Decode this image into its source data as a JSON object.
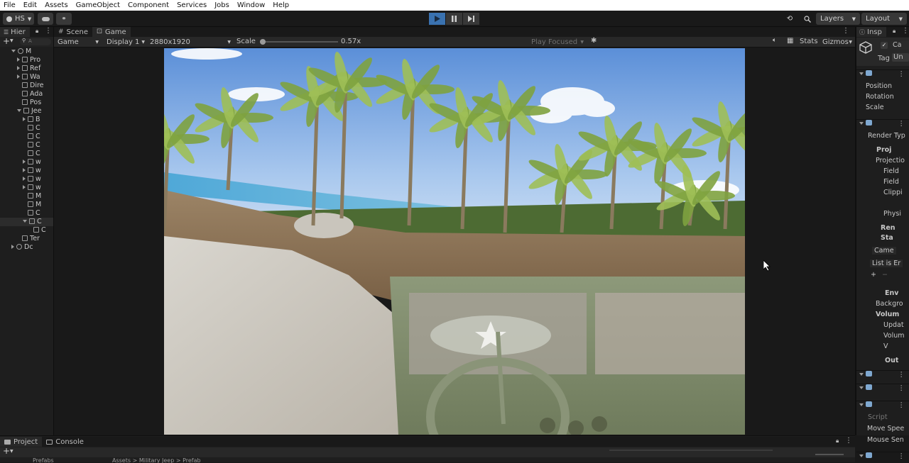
{
  "menu": [
    "File",
    "Edit",
    "Assets",
    "GameObject",
    "Component",
    "Services",
    "Jobs",
    "Window",
    "Help"
  ],
  "toolbar": {
    "account_label": "HS",
    "layers_label": "Layers",
    "layout_label": "Layout"
  },
  "hierarchy": {
    "tab_label": "Hier",
    "search_placeholder": "A",
    "items": [
      {
        "label": "M",
        "indent": 0,
        "expand": "open",
        "kind": "scene"
      },
      {
        "label": "Pro",
        "indent": 1,
        "expand": "closed",
        "kind": "object"
      },
      {
        "label": "Ref",
        "indent": 1,
        "expand": "closed",
        "kind": "object"
      },
      {
        "label": "Wa",
        "indent": 1,
        "expand": "closed",
        "kind": "object"
      },
      {
        "label": "Dire",
        "indent": 1,
        "expand": "none",
        "kind": "object"
      },
      {
        "label": "Ada",
        "indent": 1,
        "expand": "none",
        "kind": "object"
      },
      {
        "label": "Pos",
        "indent": 1,
        "expand": "none",
        "kind": "object"
      },
      {
        "label": "Jee",
        "indent": 1,
        "expand": "open",
        "kind": "object"
      },
      {
        "label": "B",
        "indent": 2,
        "expand": "closed",
        "kind": "object"
      },
      {
        "label": "C",
        "indent": 2,
        "expand": "none",
        "kind": "object"
      },
      {
        "label": "C",
        "indent": 2,
        "expand": "none",
        "kind": "object"
      },
      {
        "label": "C",
        "indent": 2,
        "expand": "none",
        "kind": "object"
      },
      {
        "label": "C",
        "indent": 2,
        "expand": "none",
        "kind": "object"
      },
      {
        "label": "w",
        "indent": 2,
        "expand": "closed",
        "kind": "object"
      },
      {
        "label": "w",
        "indent": 2,
        "expand": "closed",
        "kind": "object"
      },
      {
        "label": "w",
        "indent": 2,
        "expand": "closed",
        "kind": "object"
      },
      {
        "label": "w",
        "indent": 2,
        "expand": "closed",
        "kind": "object"
      },
      {
        "label": "M",
        "indent": 2,
        "expand": "none",
        "kind": "object"
      },
      {
        "label": "M",
        "indent": 2,
        "expand": "none",
        "kind": "object"
      },
      {
        "label": "C",
        "indent": 2,
        "expand": "none",
        "kind": "object"
      },
      {
        "label": "C",
        "indent": 2,
        "expand": "open",
        "kind": "object",
        "selected": true
      },
      {
        "label": "C",
        "indent": 3,
        "expand": "none",
        "kind": "object"
      },
      {
        "label": "Ter",
        "indent": 1,
        "expand": "none",
        "kind": "object"
      },
      {
        "label": "Dc",
        "indent": 0,
        "expand": "closed",
        "kind": "scene"
      }
    ]
  },
  "center": {
    "tabs": [
      {
        "label": "Scene",
        "icon": "hash-icon",
        "active": false
      },
      {
        "label": "Game",
        "icon": "gamepad-icon",
        "active": true
      }
    ],
    "game_toolbar": {
      "view_mode": "Game",
      "display": "Display 1",
      "resolution": "2880x1920",
      "scale_label": "Scale",
      "scale_value": "0.57x",
      "scale_fraction": 0.0,
      "play_mode": "Play Focused",
      "stats_label": "Stats",
      "gizmos_label": "Gizmos"
    }
  },
  "inspector": {
    "tab_label": "Insp",
    "object_name": "Ca",
    "tag_label": "Tag",
    "tag_value": "Un",
    "transform": [
      "Position",
      "Rotation",
      "Scale"
    ],
    "camera": {
      "render_type": "Render Typ",
      "projection_header": "Proj",
      "projection": "Projectio",
      "field1": "Field",
      "field2": "Field",
      "clipping": "Clippi",
      "physical": "Physi",
      "rendering_header": "Ren",
      "stack_header": "Sta",
      "camera_label": "Came",
      "list_empty": "List is Er",
      "environment_header": "Env",
      "background": "Backgro",
      "volumes": "Volum",
      "update": "Updat",
      "volume": "Volum",
      "v_label": "V",
      "output_header": "Out"
    },
    "script": {
      "script_label": "Script",
      "move_speed": "Move Spee",
      "mouse_sens": "Mouse Sen"
    }
  },
  "bottom": {
    "tabs": [
      {
        "label": "Project",
        "icon": "folder-icon",
        "active": true
      },
      {
        "label": "Console",
        "icon": "console-icon",
        "active": false
      }
    ],
    "folder_label": "Prefabs",
    "breadcrumb": "Assets > Military Jeep > Prefab"
  },
  "colors": {
    "accent": "#3a72b0",
    "panel": "#1e1e1e",
    "background": "#191919"
  }
}
